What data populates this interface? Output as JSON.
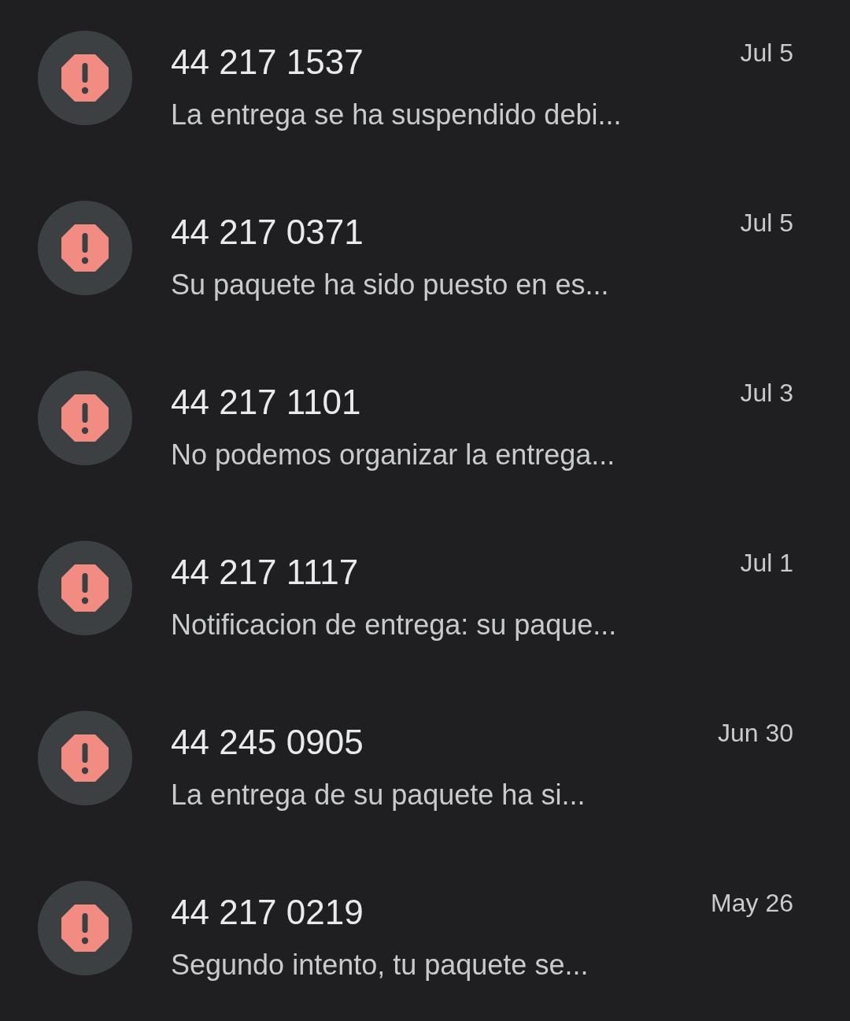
{
  "conversations": [
    {
      "sender": "44 217 1537",
      "preview": "La entrega se ha suspendido debi...",
      "date": "Jul 5",
      "kind": "spam"
    },
    {
      "sender": "44 217 0371",
      "preview": "Su paquete ha sido puesto en es...",
      "date": "Jul 5",
      "kind": "spam"
    },
    {
      "sender": "44 217 1101",
      "preview": "No podemos organizar la entrega...",
      "date": "Jul 3",
      "kind": "spam"
    },
    {
      "sender": "44 217 1117",
      "preview": "Notificacion de entrega: su paque...",
      "date": "Jul 1",
      "kind": "spam"
    },
    {
      "sender": "44 245 0905",
      "preview": "La entrega de su paquete ha si...",
      "date": "Jun 30",
      "kind": "spam"
    },
    {
      "sender": "44 217 0219",
      "preview": "Segundo intento, tu paquete se...",
      "date": "May 26",
      "kind": "spam"
    }
  ]
}
